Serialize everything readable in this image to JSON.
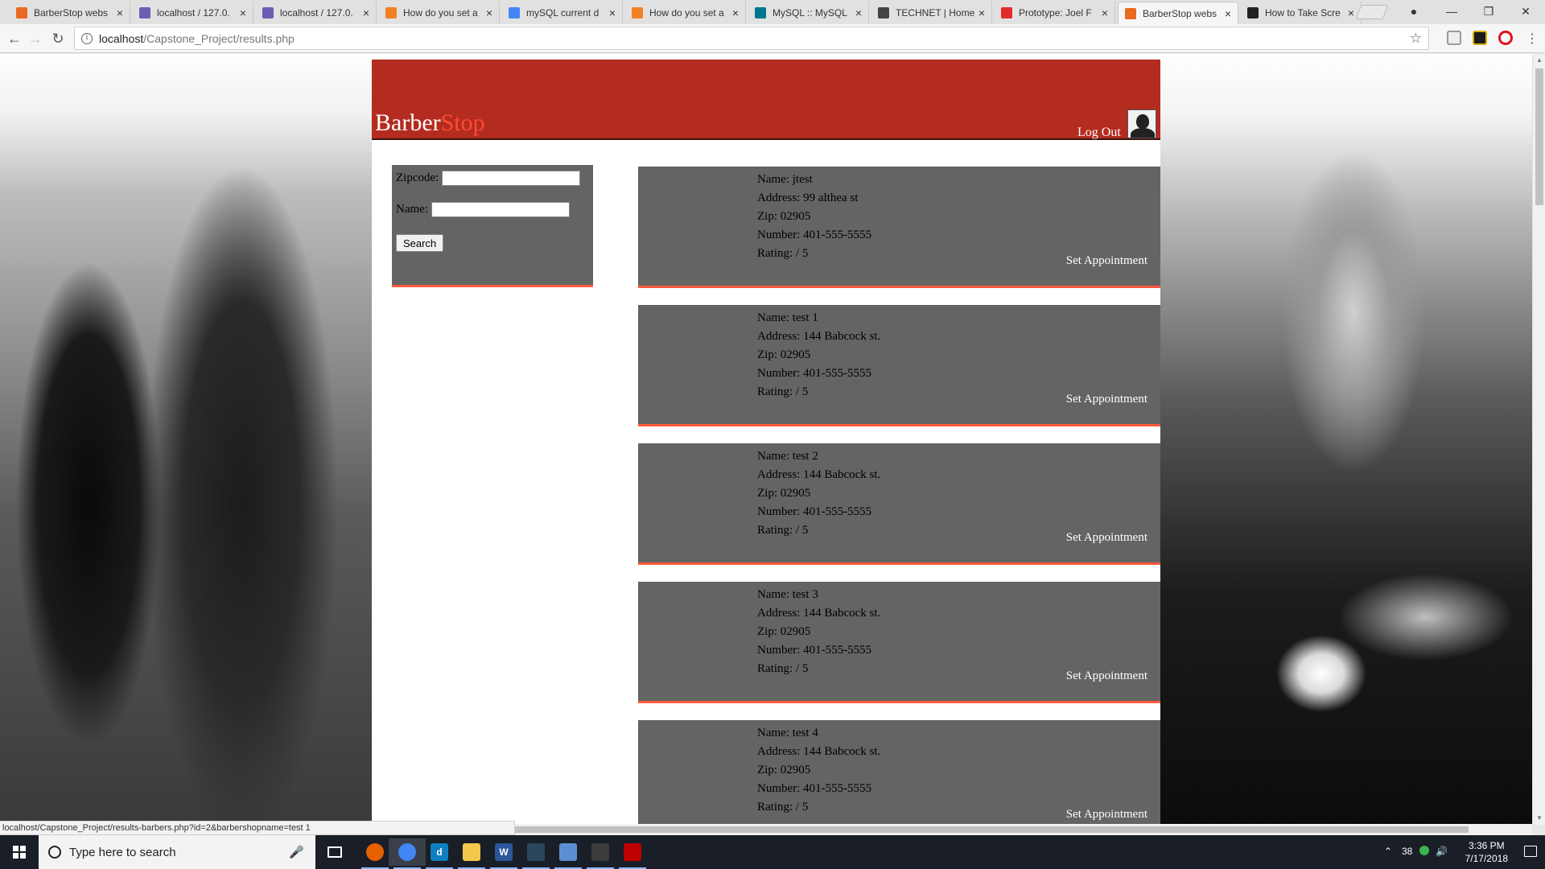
{
  "browser": {
    "tabs": [
      {
        "label": "BarberStop webs",
        "favicon_color": "#e8691f"
      },
      {
        "label": "localhost / 127.0.",
        "favicon_color": "#6a5fb3"
      },
      {
        "label": "localhost / 127.0.",
        "favicon_color": "#6a5fb3"
      },
      {
        "label": "How do you set a",
        "favicon_color": "#f48024"
      },
      {
        "label": "mySQL current d",
        "favicon_color": "#4285f4"
      },
      {
        "label": "How do you set a",
        "favicon_color": "#f48024"
      },
      {
        "label": "MySQL :: MySQL",
        "favicon_color": "#00758f"
      },
      {
        "label": "TECHNET | Home",
        "favicon_color": "#444444"
      },
      {
        "label": "Prototype: Joel F",
        "favicon_color": "#e22b2b"
      },
      {
        "label": "BarberStop webs",
        "favicon_color": "#e8691f",
        "active": true
      },
      {
        "label": "How to Take Scre",
        "favicon_color": "#222222"
      }
    ],
    "tab_close_glyph": "×",
    "address": {
      "host": "localhost",
      "path": "/Capstone_Project/results.php"
    },
    "status_url": "localhost/Capstone_Project/results-barbers.php?id=2&barbershopname=test 1"
  },
  "site": {
    "brand_part1": "Barber",
    "brand_part2": "Stop",
    "logout_label": "Log Out",
    "header_color": "#b32c1f",
    "accent_color": "#ff5a3c",
    "panel_color": "#646464"
  },
  "search": {
    "zipcode_label": "Zipcode:",
    "zipcode_value": "",
    "name_label": "Name:",
    "name_value": "",
    "button_label": "Search"
  },
  "results": [
    {
      "name": "Name: jtest",
      "address": "Address: 99 althea st",
      "zip": "Zip: 02905",
      "number": "Number: 401-555-5555",
      "rating": "Rating: / 5",
      "action": "Set Appointment"
    },
    {
      "name": "Name: test 1",
      "address": "Address: 144 Babcock st.",
      "zip": "Zip: 02905",
      "number": "Number: 401-555-5555",
      "rating": "Rating: / 5",
      "action": "Set Appointment"
    },
    {
      "name": "Name: test 2",
      "address": "Address: 144 Babcock st.",
      "zip": "Zip: 02905",
      "number": "Number: 401-555-5555",
      "rating": "Rating: / 5",
      "action": "Set Appointment"
    },
    {
      "name": "Name: test 3",
      "address": "Address: 144 Babcock st.",
      "zip": "Zip: 02905",
      "number": "Number: 401-555-5555",
      "rating": "Rating: / 5",
      "action": "Set Appointment"
    },
    {
      "name": "Name: test 4",
      "address": "Address: 144 Babcock st.",
      "zip": "Zip: 02905",
      "number": "Number: 401-555-5555",
      "rating": "Rating: / 5",
      "action": "Set Appointment"
    }
  ],
  "taskbar": {
    "search_placeholder": "Type here to search",
    "apps": [
      {
        "name": "firefox",
        "color": "#e66000",
        "glyph": ""
      },
      {
        "name": "chrome",
        "color": "#4285f4",
        "glyph": "",
        "active": true
      },
      {
        "name": "visual-studio",
        "color": "#0e7fc0",
        "glyph": "d"
      },
      {
        "name": "file-explorer",
        "color": "#f2c94c",
        "glyph": ""
      },
      {
        "name": "word",
        "color": "#2b579a",
        "glyph": "W"
      },
      {
        "name": "steam",
        "color": "#2a475e",
        "glyph": ""
      },
      {
        "name": "virtualbox",
        "color": "#5b8fd1",
        "glyph": ""
      },
      {
        "name": "git",
        "color": "#3c3c3c",
        "glyph": ""
      },
      {
        "name": "filezilla",
        "color": "#bf0000",
        "glyph": ""
      }
    ],
    "tray_temp": "38",
    "clock_time": "3:36 PM",
    "clock_date": "7/17/2018"
  }
}
